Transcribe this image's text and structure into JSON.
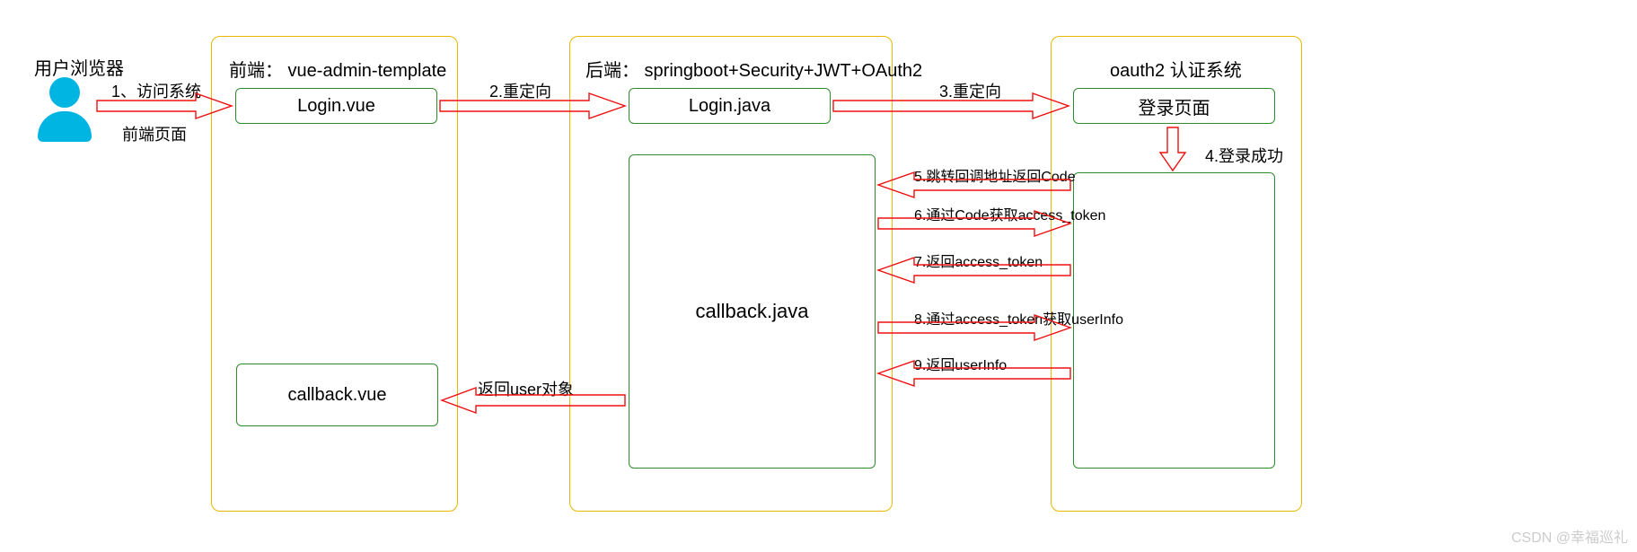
{
  "user": {
    "title": "用户浏览器"
  },
  "frontend": {
    "title": "前端： vue-admin-template",
    "login_box": "Login.vue",
    "callback_box": "callback.vue"
  },
  "backend": {
    "title": "后端： springboot+Security+JWT+OAuth2",
    "login_box": "Login.java",
    "callback_box": "callback.java"
  },
  "oauth": {
    "title": "oauth2 认证系统",
    "login_page": "登录页面"
  },
  "arrows": {
    "a1": "1、访问系统",
    "a1b": "前端页面",
    "a2": "2.重定向",
    "a3": "3.重定向",
    "a4": "4.登录成功",
    "a5": "5.跳转回调地址返回Code",
    "a6": "6.通过Code获取access_token",
    "a7": "7.返回access_token",
    "a8": "8.通过access_token获取userInfo",
    "a9": "9.返回userInfo",
    "return_user": "返回user对象"
  },
  "watermark": "CSDN @幸福巡礼"
}
